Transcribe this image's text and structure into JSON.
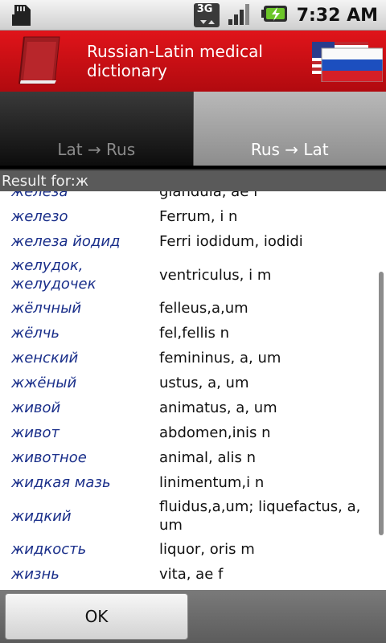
{
  "status_bar": {
    "time": "7:32 AM",
    "network_label": "3G"
  },
  "app": {
    "title": "Russian-Latin medical dictionary"
  },
  "tabs": [
    {
      "label": "Lat → Rus",
      "active": false
    },
    {
      "label": "Rus → Lat",
      "active": true
    }
  ],
  "result_header": "Result for:ж",
  "entries": [
    {
      "ru": "железа",
      "la": "glandula, ae f"
    },
    {
      "ru": "железо",
      "la": "Ferrum, i n"
    },
    {
      "ru": "железа йодид",
      "la": "Ferri iodidum, iodidi"
    },
    {
      "ru": "желудок, желудочек",
      "la": "ventriculus, i m"
    },
    {
      "ru": "жёлчный",
      "la": "felleus,a,um"
    },
    {
      "ru": "жёлчь",
      "la": "fel,fellis n"
    },
    {
      "ru": "женский",
      "la": "femininus, a, um"
    },
    {
      "ru": "жжёный",
      "la": "ustus, a, um"
    },
    {
      "ru": "живой",
      "la": "animatus, a, um"
    },
    {
      "ru": "живот",
      "la": "abdomen,inis n"
    },
    {
      "ru": "животное",
      "la": "animal, alis n"
    },
    {
      "ru": "жидкая мазь",
      "la": "linimentum,i n"
    },
    {
      "ru": "жидкий",
      "la": "fluidus,a,um; liquefactus, a, um"
    },
    {
      "ru": "жидкость",
      "la": "liquor, oris m"
    },
    {
      "ru": "жизнь",
      "la": "vita, ae f"
    }
  ],
  "footer": {
    "ok_label": "OK"
  },
  "colors": {
    "title_bar": "#d01016",
    "russian_text": "#1a2f8a"
  }
}
